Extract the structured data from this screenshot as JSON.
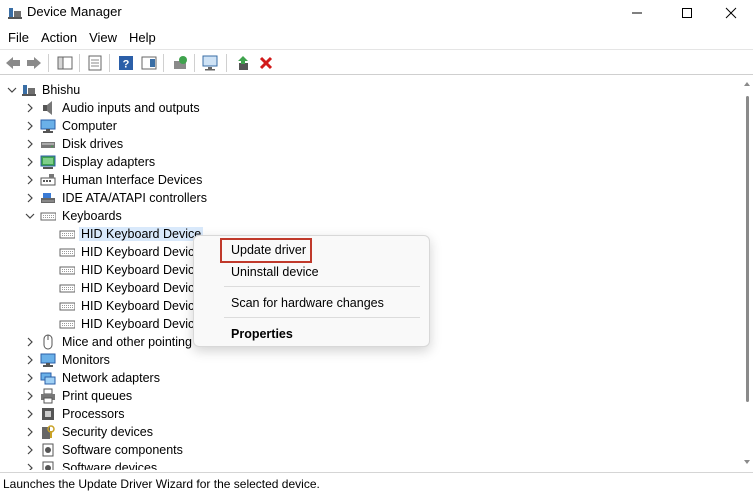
{
  "window": {
    "title": "Device Manager"
  },
  "menu": [
    "File",
    "Action",
    "View",
    "Help"
  ],
  "tree": {
    "root": "Bhishu",
    "categories": [
      {
        "label": "Audio inputs and outputs",
        "icon": "speaker-icon"
      },
      {
        "label": "Computer",
        "icon": "monitor-icon"
      },
      {
        "label": "Disk drives",
        "icon": "disk-icon"
      },
      {
        "label": "Display adapters",
        "icon": "display-adapter-icon"
      },
      {
        "label": "Human Interface Devices",
        "icon": "hid-icon"
      },
      {
        "label": "IDE ATA/ATAPI controllers",
        "icon": "ide-icon"
      },
      {
        "label": "Keyboards",
        "icon": "keyboard-icon",
        "expanded": true,
        "children": [
          "HID Keyboard Device",
          "HID Keyboard Device",
          "HID Keyboard Device",
          "HID Keyboard Device",
          "HID Keyboard Device",
          "HID Keyboard Device"
        ]
      },
      {
        "label": "Mice and other pointing",
        "icon": "mouse-icon"
      },
      {
        "label": "Monitors",
        "icon": "monitor-icon"
      },
      {
        "label": "Network adapters",
        "icon": "network-icon"
      },
      {
        "label": "Print queues",
        "icon": "printer-icon"
      },
      {
        "label": "Processors",
        "icon": "processor-icon"
      },
      {
        "label": "Security devices",
        "icon": "security-icon"
      },
      {
        "label": "Software components",
        "icon": "software-icon"
      },
      {
        "label": "Software devices",
        "icon": "software-icon"
      }
    ]
  },
  "context_menu": {
    "items": [
      "Update driver",
      "Uninstall device",
      "Scan for hardware changes",
      "Properties"
    ],
    "highlighted": "Update driver"
  },
  "status": {
    "text": "Launches the Update Driver Wizard for the selected device."
  },
  "colors": {
    "selection": "#d9e9fb",
    "highlight_border": "#c0392b",
    "uninstall_red": "#d11a1a"
  }
}
